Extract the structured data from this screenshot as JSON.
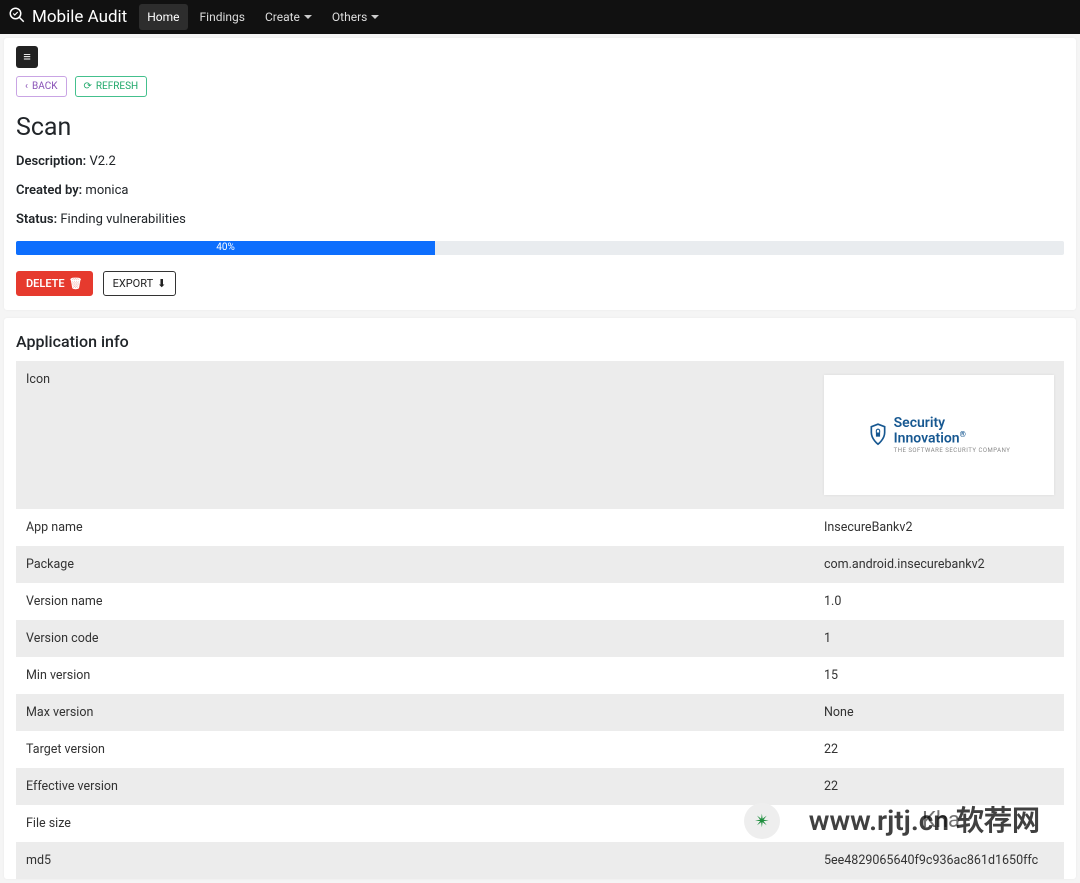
{
  "nav": {
    "brand": "Mobile Audit",
    "items": [
      {
        "label": "Home",
        "active": true
      },
      {
        "label": "Findings"
      },
      {
        "label": "Create",
        "dropdown": true
      },
      {
        "label": "Others",
        "dropdown": true
      }
    ]
  },
  "toolbar": {
    "back_label": "BACK",
    "refresh_label": "REFRESH"
  },
  "scan": {
    "title": "Scan",
    "description_label": "Description:",
    "description_value": "V2.2",
    "created_by_label": "Created by:",
    "created_by_value": "monica",
    "status_label": "Status:",
    "status_value": "Finding vulnerabilities",
    "progress_percent": 40,
    "progress_text": "40%",
    "delete_label": "DELETE",
    "export_label": "EXPORT"
  },
  "app_info": {
    "title": "Application info",
    "rows": [
      {
        "key": "Icon",
        "value_icon": true,
        "icon_title": "Security",
        "icon_title2": "Innovation",
        "icon_sub": "THE SOFTWARE SECURITY COMPANY"
      },
      {
        "key": "App name",
        "value": "InsecureBankv2"
      },
      {
        "key": "Package",
        "value": "com.android.insecurebankv2"
      },
      {
        "key": "Version name",
        "value": "1.0"
      },
      {
        "key": "Version code",
        "value": "1"
      },
      {
        "key": "Min version",
        "value": "15"
      },
      {
        "key": "Max version",
        "value": "None"
      },
      {
        "key": "Target version",
        "value": "22"
      },
      {
        "key": "Effective version",
        "value": "22"
      },
      {
        "key": "File size",
        "value": ""
      },
      {
        "key": "md5",
        "value": "5ee4829065640f9c936ac861d1650ffc"
      }
    ]
  },
  "watermark": {
    "line1": "Kha",
    "line2": "www.rjtj.cn 软荐网"
  }
}
